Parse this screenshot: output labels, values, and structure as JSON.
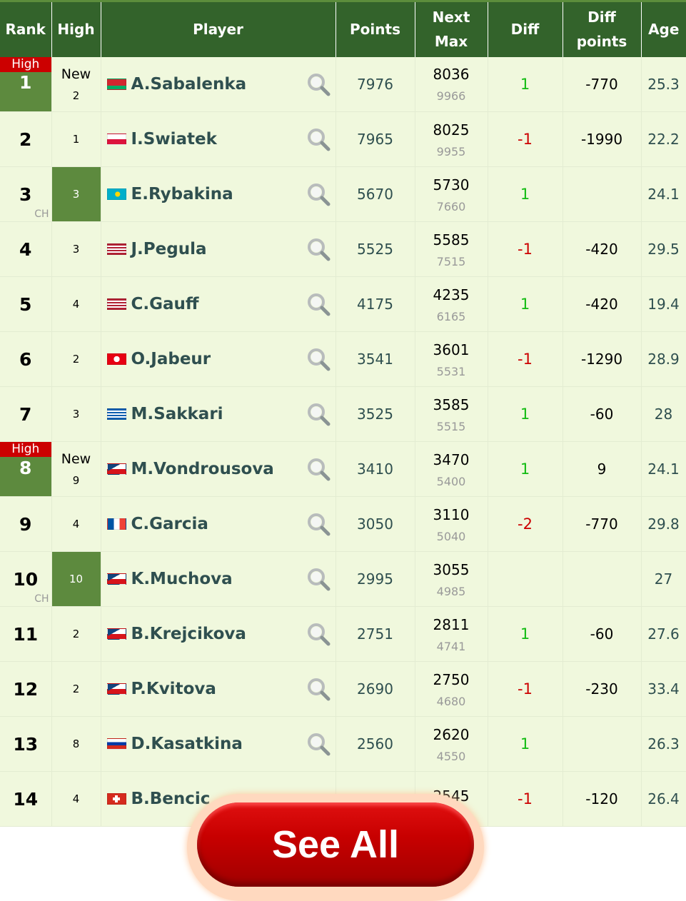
{
  "headers": {
    "rank": "Rank",
    "high": "High",
    "player": "Player",
    "points": "Points",
    "next_max_1": "Next",
    "next_max_2": "Max",
    "diff": "Diff",
    "diff_points_1": "Diff",
    "diff_points_2": "points",
    "age": "Age"
  },
  "high_badge": "High",
  "new_label": "New",
  "ch_label": "CH",
  "colors": {
    "header": "#33632b",
    "row": "#f0f8dd",
    "highlight": "#5d8a3e",
    "badge": "#cc0000",
    "up": "#11bb11",
    "down": "#cc0000"
  },
  "rows": [
    {
      "rank": "1",
      "rank_high": true,
      "high": "2",
      "high_new": true,
      "flag": "belarus",
      "player": "A.Sabalenka",
      "points": "7976",
      "next": "8036",
      "max": "9966",
      "diff": "1",
      "diff_points": "-770",
      "age": "25.3"
    },
    {
      "rank": "2",
      "high": "1",
      "flag": "poland",
      "player": "I.Swiatek",
      "points": "7965",
      "next": "8025",
      "max": "9955",
      "diff": "-1",
      "diff_points": "-1990",
      "age": "22.2"
    },
    {
      "rank": "3",
      "ch": true,
      "high": "3",
      "high_hl": true,
      "flag": "kazakhstan",
      "player": "E.Rybakina",
      "points": "5670",
      "next": "5730",
      "max": "7660",
      "diff": "1",
      "diff_points": "",
      "age": "24.1"
    },
    {
      "rank": "4",
      "high": "3",
      "flag": "usa",
      "player": "J.Pegula",
      "points": "5525",
      "next": "5585",
      "max": "7515",
      "diff": "-1",
      "diff_points": "-420",
      "age": "29.5"
    },
    {
      "rank": "5",
      "high": "4",
      "flag": "usa",
      "player": "C.Gauff",
      "points": "4175",
      "next": "4235",
      "max": "6165",
      "diff": "1",
      "diff_points": "-420",
      "age": "19.4"
    },
    {
      "rank": "6",
      "high": "2",
      "flag": "tunisia",
      "player": "O.Jabeur",
      "points": "3541",
      "next": "3601",
      "max": "5531",
      "diff": "-1",
      "diff_points": "-1290",
      "age": "28.9"
    },
    {
      "rank": "7",
      "high": "3",
      "flag": "greece",
      "player": "M.Sakkari",
      "points": "3525",
      "next": "3585",
      "max": "5515",
      "diff": "1",
      "diff_points": "-60",
      "age": "28"
    },
    {
      "rank": "8",
      "rank_high": true,
      "high": "9",
      "high_new": true,
      "flag": "czech",
      "player": "M.Vondrousova",
      "points": "3410",
      "next": "3470",
      "max": "5400",
      "diff": "1",
      "diff_points": "9",
      "age": "24.1"
    },
    {
      "rank": "9",
      "high": "4",
      "flag": "france",
      "player": "C.Garcia",
      "points": "3050",
      "next": "3110",
      "max": "5040",
      "diff": "-2",
      "diff_points": "-770",
      "age": "29.8"
    },
    {
      "rank": "10",
      "ch": true,
      "high": "10",
      "high_hl": true,
      "flag": "czech",
      "player": "K.Muchova",
      "points": "2995",
      "next": "3055",
      "max": "4985",
      "diff": "",
      "diff_points": "",
      "age": "27"
    },
    {
      "rank": "11",
      "high": "2",
      "flag": "czech",
      "player": "B.Krejcikova",
      "points": "2751",
      "next": "2811",
      "max": "4741",
      "diff": "1",
      "diff_points": "-60",
      "age": "27.6"
    },
    {
      "rank": "12",
      "high": "2",
      "flag": "czech",
      "player": "P.Kvitova",
      "points": "2690",
      "next": "2750",
      "max": "4680",
      "diff": "-1",
      "diff_points": "-230",
      "age": "33.4"
    },
    {
      "rank": "13",
      "high": "8",
      "flag": "russia",
      "player": "D.Kasatkina",
      "points": "2560",
      "next": "2620",
      "max": "4550",
      "diff": "1",
      "diff_points": "",
      "age": "26.3"
    },
    {
      "rank": "14",
      "high": "4",
      "flag": "switzerland",
      "player": "B.Bencic",
      "points": "",
      "next": "2545",
      "max": "",
      "diff": "-1",
      "diff_points": "-120",
      "age": "26.4"
    }
  ],
  "see_all": "See All"
}
